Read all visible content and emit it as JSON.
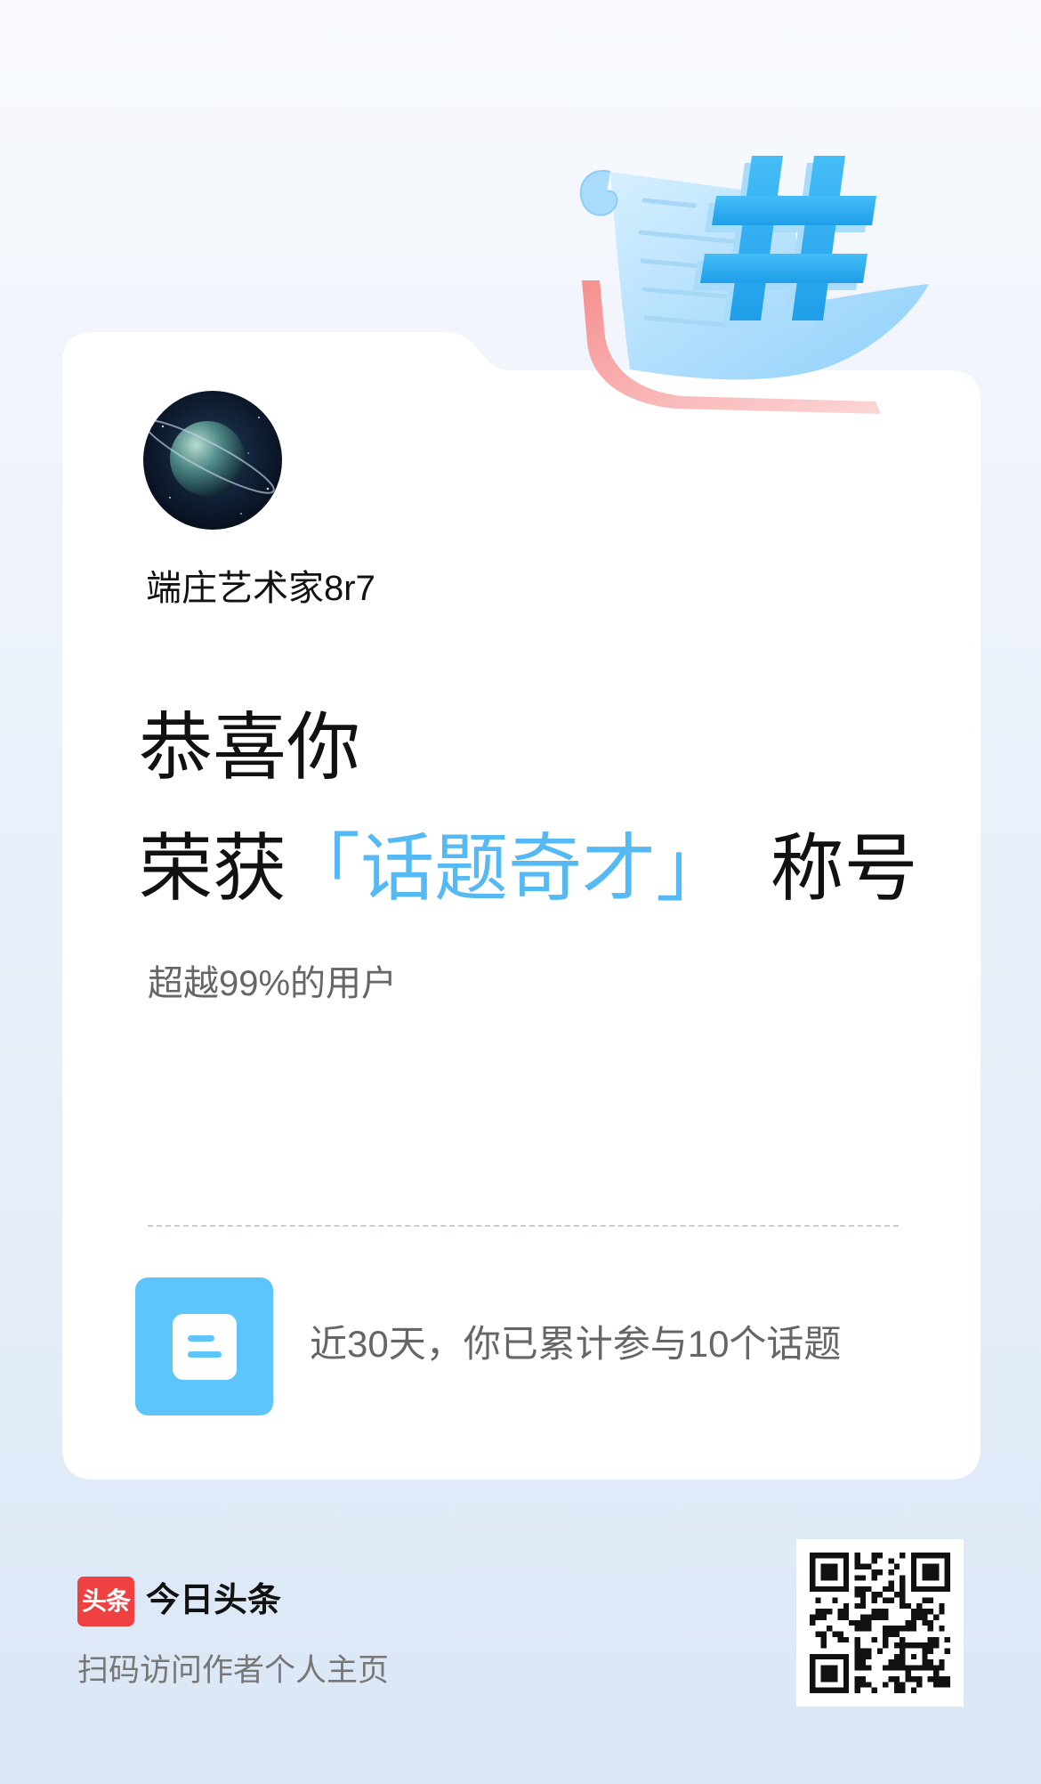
{
  "user": {
    "name": "端庄艺术家8r7"
  },
  "headline": {
    "line1": "恭喜你",
    "prefix": "荣获",
    "title": "「话题奇才」",
    "suffix": "称号"
  },
  "rank_text": "超越99%的用户",
  "stat": {
    "icon": "document-icon",
    "text": "近30天，你已累计参与10个话题"
  },
  "footer": {
    "logo_text": "头条",
    "app_name": "今日头条",
    "scan_hint": "扫码访问作者个人主页",
    "qr_icon": "qr-code-icon"
  },
  "decoration": {
    "illustration_icon": "hashtag-scroll-icon",
    "avatar_icon": "planet-avatar-icon"
  },
  "colors": {
    "accent": "#55b9f3",
    "icon_bg": "#5ec5fb",
    "logo_red": "#f04142"
  }
}
